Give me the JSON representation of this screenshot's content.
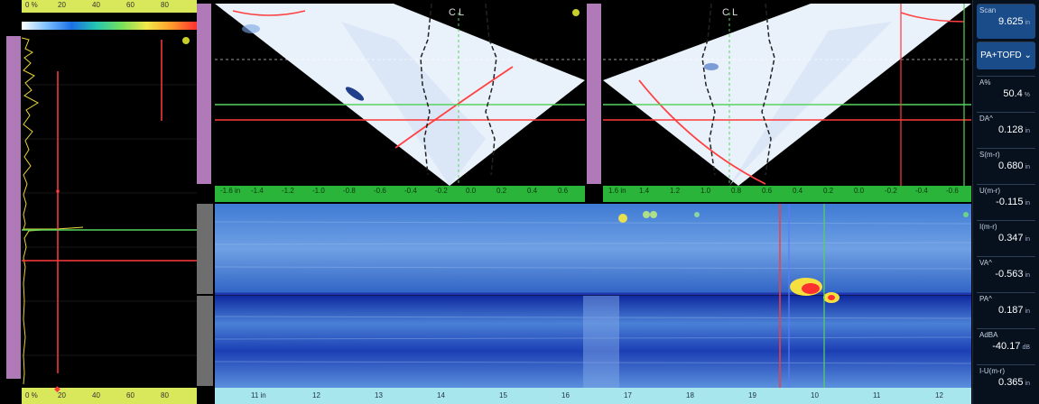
{
  "left_ascan": {
    "top_ticks": [
      "0 %",
      "20",
      "40",
      "60",
      "80"
    ],
    "bottom_ticks": [
      "0 %",
      "20",
      "40",
      "60",
      "80"
    ]
  },
  "sector_left": {
    "cl_label": "C L",
    "ticks": [
      "-1.6 in",
      "-1.4",
      "-1.2",
      "-1.0",
      "-0.8",
      "-0.6",
      "-0.4",
      "-0.2",
      "0.0",
      "0.2",
      "0.4",
      "0.6"
    ]
  },
  "sector_right": {
    "cl_label": "C L",
    "ticks": [
      "1.6 in",
      "1.4",
      "1.2",
      "1.0",
      "0.8",
      "0.6",
      "0.4",
      "0.2",
      "0.0",
      "-0.2",
      "-0.4",
      "-0.6"
    ]
  },
  "bscan": {
    "ticks": [
      "11 in",
      "12",
      "13",
      "14",
      "15",
      "16",
      "17",
      "18",
      "19",
      "10",
      "11",
      "12"
    ]
  },
  "side_panel": {
    "items": [
      {
        "label": "Scan",
        "value": "9.625",
        "unit": "in"
      },
      {
        "label": "",
        "value": "PA+TOFD",
        "unit": ""
      },
      {
        "label": "A%",
        "value": "50.4",
        "unit": "%"
      },
      {
        "label": "DA^",
        "value": "0.128",
        "unit": "in"
      },
      {
        "label": "S(m-r)",
        "value": "0.680",
        "unit": "in"
      },
      {
        "label": "U(m-r)",
        "value": "-0.115",
        "unit": "in"
      },
      {
        "label": "I(m-r)",
        "value": "0.347",
        "unit": "in"
      },
      {
        "label": "VA^",
        "value": "-0.563",
        "unit": "in"
      },
      {
        "label": "PA^",
        "value": "0.187",
        "unit": "in"
      },
      {
        "label": "AdBA",
        "value": "-40.17",
        "unit": "dB"
      },
      {
        "label": "I-U(m-r)",
        "value": "0.365",
        "unit": "in"
      }
    ]
  },
  "colors": {
    "ruler_yellow": "#d8e85a",
    "ruler_green": "#2ab43a",
    "ruler_cyan": "#a8e6ee",
    "cursor_red": "#ff3a3a",
    "cursor_green": "#56d35e",
    "panel_bg": "#07101d",
    "accent_blue": "#1a4c8a"
  }
}
